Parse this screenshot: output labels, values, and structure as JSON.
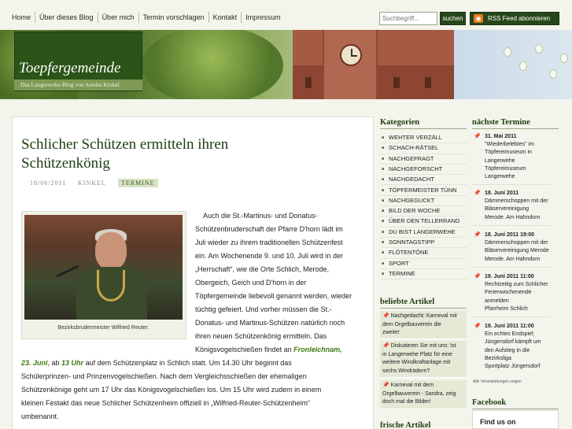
{
  "nav": {
    "items": [
      "Home",
      "Über dieses Blog",
      "Über mich",
      "Termin vorschlagen",
      "Kontakt",
      "Impressum"
    ]
  },
  "search": {
    "placeholder": "Suchbegriff...",
    "button": "suchen"
  },
  "rss": {
    "label": "RSS Feed abonnieren",
    "icon": "rss-icon"
  },
  "header": {
    "title": "Toepfergemeinde",
    "subtitle": "Das Langerwehe-Blog von Sandra Kinkel"
  },
  "post": {
    "title_line1": "Schlicher Schützen ermitteln ihren",
    "title_line2": "Schützenkönig",
    "date": "18/06/2011",
    "author": "KINKEL",
    "tag": "TERMINE",
    "photo_caption": "Bezirksbrudermeister Wilfried Reuter.",
    "lines": [
      "Auch die St.-Martinus- und Donatus-",
      "Schützenbruderschaft der Pfarre D'horn lädt im",
      "Juli wieder zu ihrem traditionellen Schützenfest",
      "ein. Am Wochenende 9. und 10. Juli wird in der",
      "„Herrschaft“, wie die Orte Schlich, Merode,",
      "Obergeich, Geich und D'horn in der",
      "Töpfergemeinde liebevoll genannt werden, wieder",
      "tüchtig gefeiert. Und vorher müssen die St.-",
      "Donatus- und Martinus-Schützen natürlich noch",
      "ihren neuen Schützenkönig ermitteln. Das",
      "Königsvogelschießen findet an"
    ],
    "highlight_1": "Fronleichnam,",
    "highlight_2": "23. Juni",
    "line_12_mid": ", ab",
    "highlight_3": "13 Uhr",
    "line_12_end": "auf dem Schützenplatz in Schlich statt. Um 14.30 Uhr beginnt das",
    "tail_lines": [
      "Schülerprinzen- und Prinzenvogelschießen. Nach dem Vergleichsschießen der ehemaligen",
      "Schützenkönige geht um 17 Uhr das Königsvogelschießen los. Um 15 Uhr wird zudem in einem",
      "kleinen Festakt das neue Schlicher Schützenheim offiziell in „Wilfried-Reuter-Schützenheim“",
      "umbenannt."
    ]
  },
  "categories": {
    "heading": "Kategorien",
    "items": [
      "WEHTER VERZÄLL",
      "SCHACH-RÄTSEL",
      "NACHGEFRAGT",
      "NACHGEFORSCHT",
      "NACHGEDACHT",
      "TÖPFERMEISTER TÜNN",
      "NACHGEGUCKT",
      "BILD DER WOCHE",
      "ÜBER DEN TELLERRAND",
      "DU BIST LANGERWEHE",
      "SONNTAGSTIPP",
      "FLÖTENTÖNE",
      "SPORT",
      "TERMINE"
    ]
  },
  "popular": {
    "heading": "beliebte Artikel",
    "items": [
      [
        "Nachgedacht: Karneval mit",
        "dem Orgelbauverein die",
        "zweite!"
      ],
      [
        "Diskutieren Sie mit uns: Ist",
        "in Langerwehe Platz für eine",
        "weitere Windkraftanlage mit",
        "sechs Windrädern?"
      ],
      [
        "Karneval mit dem",
        "Orgelbauverein - Sandra, zeig",
        "doch mal die Bilder!"
      ]
    ]
  },
  "fresh": {
    "heading": "frische Artikel"
  },
  "events": {
    "heading": "nächste Termine",
    "items": [
      {
        "date": "31. Mai 2011",
        "lines": [
          "\"Wiederbelebtes\" im",
          "Töpfereimuseum in",
          "Langerwehe",
          "Töpfereimuseum",
          "Langerwehe"
        ]
      },
      {
        "date": "18. Juni 2011",
        "lines": [
          "Dämmerschoppen mit der",
          "Bläservereinigung",
          "Merode. Am Hahndorn"
        ]
      },
      {
        "date": "18. Juni 2011 19:00",
        "lines": [
          "Dämmerschoppen mit der",
          "Bläservereinigung Merode",
          "Merode. Am Hahndorn"
        ]
      },
      {
        "date": "19. Juni 2011 11:00",
        "lines": [
          "Rechtzeitig zum Schlicher",
          "Ferienwochenende",
          "anmelden",
          "Pfarrheim Schlich"
        ]
      },
      {
        "date": "19. Juni 2011 11:00",
        "lines": [
          "Ein echtes Endspiel:",
          "Jüngersdorf kämpft um",
          "den Aufstieg in die",
          "Bezirksliga",
          "Sportplatz Jüngersdorf"
        ]
      }
    ],
    "all_link": "Alle Veranstaltungen zeigen"
  },
  "facebook": {
    "heading": "Facebook",
    "find_us": "Find us on"
  }
}
